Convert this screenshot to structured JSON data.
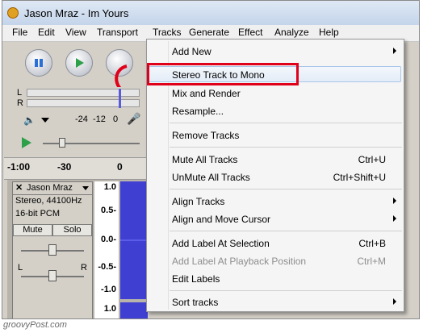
{
  "window": {
    "title": "Jason Mraz - Im Yours"
  },
  "menubar": {
    "items": [
      "File",
      "Edit",
      "View",
      "Transport",
      "Tracks",
      "Generate",
      "Effect",
      "Analyze",
      "Help"
    ],
    "active": "Tracks"
  },
  "meters": {
    "left_channel": "L",
    "right_channel": "R"
  },
  "volume": {
    "scale_a": "-24",
    "scale_b": "-12",
    "scale_c": "0"
  },
  "ruler": {
    "mark_a": "-1:00",
    "mark_b": "-30",
    "mark_c": "0"
  },
  "track": {
    "name": "Jason Mraz",
    "format": "Stereo, 44100Hz",
    "bit_depth": "16-bit PCM",
    "mute_label": "Mute",
    "solo_label": "Solo",
    "pan_left": "L",
    "pan_right": "R"
  },
  "scale": {
    "top": "1.0",
    "half": "0.5-",
    "zero": "0.0-",
    "neg_half": "-0.5-",
    "bottom": "-1.0",
    "top2": "1.0"
  },
  "tracks_menu": {
    "add_new": "Add New",
    "stereo_to_mono": "Stereo Track to Mono",
    "mix_and_render": "Mix and Render",
    "resample": "Resample...",
    "remove_tracks": "Remove Tracks",
    "mute_all": "Mute All Tracks",
    "mute_all_shortcut": "Ctrl+U",
    "unmute_all": "UnMute All Tracks",
    "unmute_all_shortcut": "Ctrl+Shift+U",
    "align_tracks": "Align Tracks",
    "align_move_cursor": "Align and Move Cursor",
    "add_label_selection": "Add Label At Selection",
    "add_label_selection_shortcut": "Ctrl+B",
    "add_label_playback": "Add Label At Playback Position",
    "add_label_playback_shortcut": "Ctrl+M",
    "edit_labels": "Edit Labels",
    "sort_tracks": "Sort tracks"
  },
  "footer": {
    "watermark": "groovyPost.com"
  },
  "colors": {
    "highlight_red": "#e0001a",
    "waveform": "#3f3fd2",
    "menu_hover": "#cfe0f5"
  }
}
